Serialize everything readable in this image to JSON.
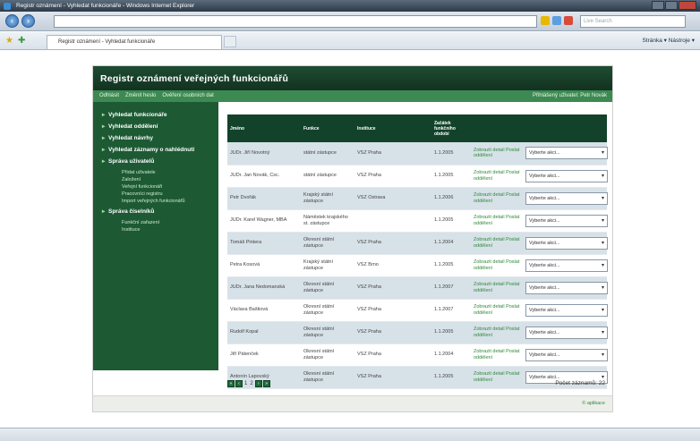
{
  "window": {
    "title": "Registr oznámení - Vyhledat funkcionáře - Windows Internet Explorer",
    "search_placeholder": "Live Search",
    "tab_label": "Registr oznámení - Vyhledat funkcionáře",
    "command_bar": "Stránka ▾  Nástroje ▾"
  },
  "app": {
    "title": "Registr oznámení veřejných funkcionářů",
    "menu": [
      "Odhlásit",
      "Změnit heslo",
      "Ověření osobních dat"
    ],
    "login_info": "Přihlášený uživatel: Petr Novák"
  },
  "sidebar": {
    "items": [
      {
        "label": "Vyhledat funkcionáře",
        "subs": []
      },
      {
        "label": "Vyhledat oddělení",
        "subs": []
      },
      {
        "label": "Vyhledat návrhy",
        "subs": []
      },
      {
        "label": "Vyhledat záznamy o nahlédnutí",
        "subs": []
      },
      {
        "label": "Správa uživatelů",
        "subs": [
          "Přidat uživatele",
          "Založení",
          "Veřejní funkcionáři",
          "Pracovníci registru",
          "Import veřejných funkcionářů"
        ]
      },
      {
        "label": "Správa číselníků",
        "subs": [
          "Funkční zařazení",
          "Instituce"
        ]
      }
    ]
  },
  "table": {
    "headers": [
      "Jméno",
      "Funkce",
      "Instituce",
      "Začátek funkčního období",
      "",
      ""
    ],
    "action_labels": {
      "show": "Zobrazit detail",
      "send": "Poslat oddělení"
    },
    "select_placeholder": "Vyberte akci...",
    "rows": [
      {
        "name": "JUDr. Jiří Novotný",
        "function": "státní zástupce",
        "institution": "VSZ Praha",
        "start": "1.1.2005"
      },
      {
        "name": "JUDr. Jan Novák, Csc.",
        "function": "státní zástupce",
        "institution": "VSZ Praha",
        "start": "1.1.2005"
      },
      {
        "name": "Petr Dvořák",
        "function": "Krajský státní zástupce",
        "institution": "VSZ Ostrava",
        "start": "1.1.2006"
      },
      {
        "name": "JUDr. Karel Wagner, MBA",
        "function": "Náměstek krajského st. zástupce",
        "institution": "",
        "start": "1.1.2005"
      },
      {
        "name": "Tomáš Pintera",
        "function": "Okresní státní zástupce",
        "institution": "VSZ Praha",
        "start": "1.1.2004"
      },
      {
        "name": "Petra Kosová",
        "function": "Krajský státní zástupce",
        "institution": "VSZ Brno",
        "start": "1.1.2005"
      },
      {
        "name": "JUDr. Jana Nedomanská",
        "function": "Okresní státní zástupce",
        "institution": "VSZ Praha",
        "start": "1.1.2007"
      },
      {
        "name": "Václava Baštiová",
        "function": "Okresní státní zástupce",
        "institution": "VSZ Praha",
        "start": "1.1.2007"
      },
      {
        "name": "Rudolf Kopal",
        "function": "Okresní státní zástupce",
        "institution": "VSZ Praha",
        "start": "1.1.2005"
      },
      {
        "name": "Jiří Pátenček",
        "function": "Okresní státní zástupce",
        "institution": "VSZ Praha",
        "start": "1.1.2004"
      },
      {
        "name": "Antonín Lapovský",
        "function": "Okresní státní zástupce",
        "institution": "VSZ Praha",
        "start": "1.1.2005"
      }
    ]
  },
  "pager": {
    "buttons": [
      "«",
      "‹",
      "›",
      "»"
    ],
    "pages": [
      "1",
      "2"
    ]
  },
  "record_count": "Počet záznamů: 22",
  "footer_link": "© aplikace",
  "colors": {
    "header": "#12432a",
    "sidebar": "#1d5a34",
    "menubar": "#3c8a52",
    "row_alt": "#d7e1e8",
    "link": "#2f8a3a"
  }
}
